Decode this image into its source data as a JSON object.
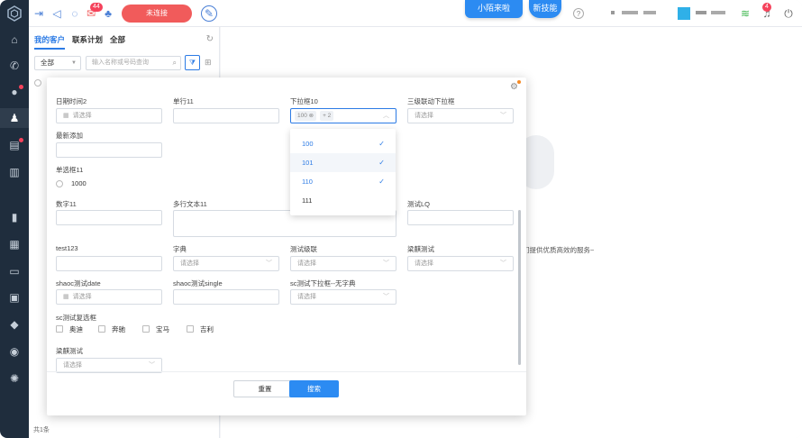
{
  "topbar": {
    "badge_missed": "44",
    "unconnected_label": "未连接",
    "pill_left": "小陌来啦",
    "pill_right": "新技能",
    "badge_alerts": "4"
  },
  "nav": {
    "items": [
      "home-icon",
      "phone-icon",
      "chat-icon",
      "user-icon",
      "doc-icon",
      "book-icon",
      "bar-chart-icon",
      "dashboard-icon",
      "monitor-icon",
      "calendar-icon",
      "shield-icon",
      "message-icon",
      "settings-icon"
    ]
  },
  "customer_panel": {
    "tabs": [
      "我的客户",
      "联系计划",
      "全部"
    ],
    "scope_value": "全部",
    "search_placeholder": "输入名称或号码查询",
    "footer_count": "共1条"
  },
  "main": {
    "service_text": "们提供优质高效的服务~"
  },
  "modal": {
    "fields": {
      "date2_label": "日期时间2",
      "date2_placeholder": "请选择",
      "single11_label": "单行11",
      "dropdown10_label": "下拉框10",
      "dropdown10_tag": "100",
      "dropdown10_more": "+ 2",
      "cascade_label": "三级联动下拉框",
      "cascade_placeholder": "请选择",
      "newest_label": "最新添加",
      "radio11_label": "单选框11",
      "radio11_option": "1000",
      "number11_label": "数字11",
      "multiline11_label": "多行文本11",
      "testlq_label": "测试LQ",
      "test123_label": "test123",
      "dict_label": "字典",
      "dict_placeholder": "请选择",
      "testcascade_label": "测试级联",
      "testcascade_placeholder": "请选择",
      "liangqi_label": "梁麒测试",
      "liangqi_placeholder": "请选择",
      "shaocdate_label": "shaoc测试date",
      "shaocdate_placeholder": "请选择",
      "shaocsingle_label": "shaoc测试single",
      "scdropdown_label": "sc测试下拉框--无字典",
      "scdropdown_placeholder": "请选择",
      "sccheck_label": "sc测试复选框",
      "sccheck_options": [
        "奥迪",
        "奔驰",
        "宝马",
        "吉利"
      ],
      "liangqi2_label": "梁麒测试",
      "liangqi2_placeholder": "请选择"
    },
    "dropdown_options": [
      {
        "label": "100",
        "selected": true
      },
      {
        "label": "101",
        "selected": true
      },
      {
        "label": "110",
        "selected": true
      },
      {
        "label": "111",
        "selected": false
      }
    ],
    "reset_label": "重置",
    "search_label": "搜索"
  }
}
